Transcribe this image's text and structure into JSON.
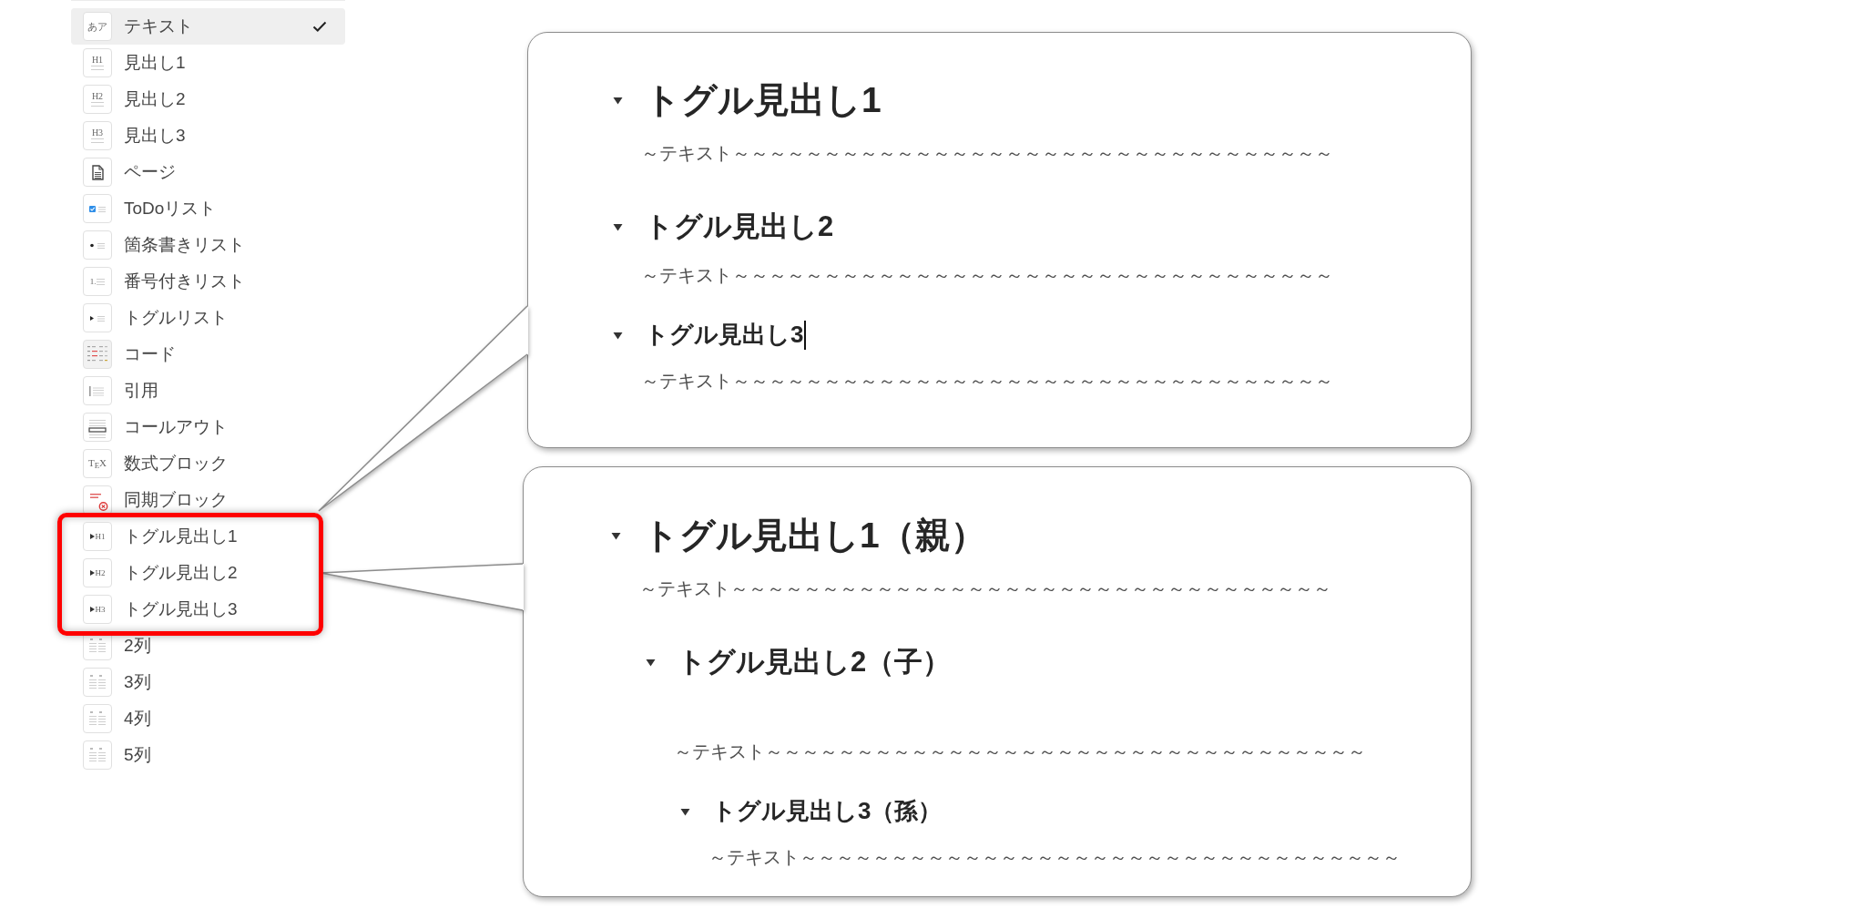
{
  "menu": {
    "items": [
      {
        "kind": "text",
        "icon_text": "あア",
        "label": "テキスト",
        "selected": true,
        "highlighted": false
      },
      {
        "kind": "heading",
        "icon_text": "H1",
        "label": "見出し1",
        "selected": false,
        "highlighted": false
      },
      {
        "kind": "heading",
        "icon_text": "H2",
        "label": "見出し2",
        "selected": false,
        "highlighted": false
      },
      {
        "kind": "heading",
        "icon_text": "H3",
        "label": "見出し3",
        "selected": false,
        "highlighted": false
      },
      {
        "kind": "page",
        "label": "ページ",
        "selected": false,
        "highlighted": false
      },
      {
        "kind": "todo",
        "label": "ToDoリスト",
        "selected": false,
        "highlighted": false
      },
      {
        "kind": "bullet",
        "label": "箇条書きリスト",
        "selected": false,
        "highlighted": false
      },
      {
        "kind": "numbered",
        "icon_text": "1.",
        "label": "番号付きリスト",
        "selected": false,
        "highlighted": false
      },
      {
        "kind": "toggle",
        "label": "トグルリスト",
        "selected": false,
        "highlighted": false
      },
      {
        "kind": "code",
        "label": "コード",
        "selected": false,
        "highlighted": false
      },
      {
        "kind": "quote",
        "label": "引用",
        "selected": false,
        "highlighted": false
      },
      {
        "kind": "callout",
        "label": "コールアウト",
        "selected": false,
        "highlighted": false
      },
      {
        "kind": "equation",
        "icon_text": "T$_{E}$X",
        "label": "数式ブロック",
        "selected": false,
        "highlighted": false
      },
      {
        "kind": "synced",
        "label": "同期ブロック",
        "selected": false,
        "highlighted": false
      },
      {
        "kind": "toggleheading",
        "icon_text": "H1",
        "label": "トグル見出し1",
        "selected": false,
        "highlighted": true
      },
      {
        "kind": "toggleheading",
        "icon_text": "H2",
        "label": "トグル見出し2",
        "selected": false,
        "highlighted": true
      },
      {
        "kind": "toggleheading",
        "icon_text": "H3",
        "label": "トグル見出し3",
        "selected": false,
        "highlighted": true
      },
      {
        "kind": "columns",
        "label": "2列",
        "selected": false,
        "highlighted": false
      },
      {
        "kind": "columns",
        "label": "3列",
        "selected": false,
        "highlighted": false
      },
      {
        "kind": "columns",
        "label": "4列",
        "selected": false,
        "highlighted": false
      },
      {
        "kind": "columns",
        "label": "5列",
        "selected": false,
        "highlighted": false
      }
    ]
  },
  "callouts": [
    {
      "blocks": [
        {
          "kind": "heading1",
          "title": "トグル見出し1",
          "expanded": true,
          "focused": false,
          "children": [
            {
              "kind": "text",
              "text": "～テキスト～～～～～～～～～～～～～～～～～～～～～～～～～～～～～～～～～"
            }
          ]
        },
        {
          "kind": "heading2",
          "title": "トグル見出し2",
          "expanded": true,
          "focused": false,
          "children": [
            {
              "kind": "text",
              "text": "～テキスト～～～～～～～～～～～～～～～～～～～～～～～～～～～～～～～～～"
            }
          ]
        },
        {
          "kind": "heading3",
          "title": "トグル見出し3",
          "expanded": true,
          "focused": true,
          "children": [
            {
              "kind": "text",
              "text": "～テキスト～～～～～～～～～～～～～～～～～～～～～～～～～～～～～～～～～"
            }
          ]
        }
      ]
    },
    {
      "blocks": [
        {
          "kind": "heading1",
          "title": "トグル見出し1（親）",
          "expanded": true,
          "focused": false,
          "children": [
            {
              "kind": "text",
              "text": "～テキスト～～～～～～～～～～～～～～～～～～～～～～～～～～～～～～～～～"
            },
            {
              "kind": "heading2",
              "title": "トグル見出し2（子）",
              "expanded": true,
              "focused": false,
              "children": [
                {
                  "kind": "text",
                  "text": "～テキスト～～～～～～～～～～～～～～～～～～～～～～～～～～～～～～～～～"
                },
                {
                  "kind": "heading3",
                  "title": "トグル見出し3（孫）",
                  "expanded": true,
                  "focused": false,
                  "children": [
                    {
                      "kind": "text",
                      "text": "～テキスト～～～～～～～～～～～～～～～～～～～～～～～～～～～～～～～～～"
                    }
                  ]
                }
              ]
            }
          ]
        }
      ]
    }
  ]
}
